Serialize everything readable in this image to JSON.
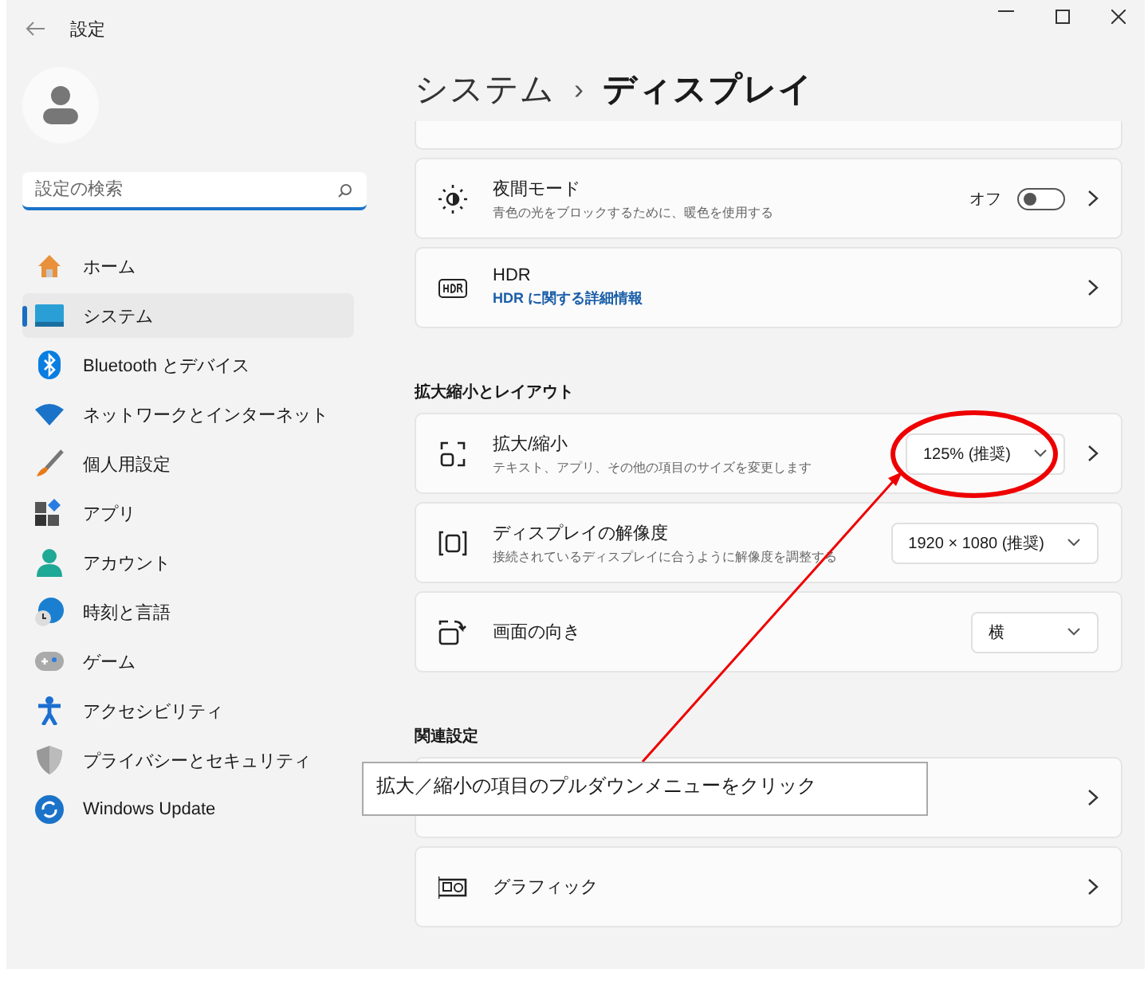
{
  "window": {
    "title": "設定"
  },
  "sidebar": {
    "search": {
      "placeholder": "設定の検索"
    },
    "items": [
      {
        "label": "ホーム",
        "selected": false
      },
      {
        "label": "システム",
        "selected": true
      },
      {
        "label": "Bluetooth とデバイス",
        "selected": false
      },
      {
        "label": "ネットワークとインターネット",
        "selected": false
      },
      {
        "label": "個人用設定",
        "selected": false
      },
      {
        "label": "アプリ",
        "selected": false
      },
      {
        "label": "アカウント",
        "selected": false
      },
      {
        "label": "時刻と言語",
        "selected": false
      },
      {
        "label": "ゲーム",
        "selected": false
      },
      {
        "label": "アクセシビリティ",
        "selected": false
      },
      {
        "label": "プライバシーとセキュリティ",
        "selected": false
      },
      {
        "label": "Windows Update",
        "selected": false
      }
    ]
  },
  "breadcrumb": {
    "parent": "システム",
    "separator": "›",
    "current": "ディスプレイ"
  },
  "sections": [
    {
      "cards": [
        {
          "kind": "stub"
        },
        {
          "kind": "toggle",
          "title": "夜間モード",
          "subtitle": "青色の光をブロックするために、暖色を使用する",
          "toggle": {
            "label": "オフ",
            "on": false
          }
        },
        {
          "kind": "link",
          "title": "HDR",
          "link": "HDR に関する詳細情報"
        }
      ]
    },
    {
      "heading": "拡大縮小とレイアウト",
      "cards": [
        {
          "kind": "dropdown",
          "title": "拡大/縮小",
          "subtitle": "テキスト、アプリ、その他の項目のサイズを変更します",
          "dropdown": {
            "value": "125% (推奨)"
          },
          "chevron": true
        },
        {
          "kind": "dropdown",
          "title": "ディスプレイの解像度",
          "subtitle": "接続されているディスプレイに合うように解像度を調整する",
          "dropdown": {
            "value": "1920 × 1080 (推奨)"
          },
          "chevron": false
        },
        {
          "kind": "dropdown",
          "title": "画面の向き",
          "dropdown": {
            "value": "横"
          },
          "chevron": false
        }
      ]
    },
    {
      "heading": "関連設定",
      "cards": [
        {
          "kind": "hidden"
        },
        {
          "kind": "link",
          "title": "グラフィック"
        }
      ]
    }
  ],
  "annotation": {
    "text": "拡大／縮小の項目のプルダウンメニューをクリック"
  }
}
